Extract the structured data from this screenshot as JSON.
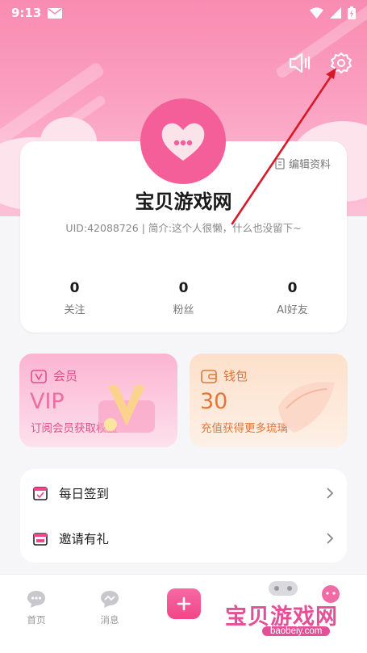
{
  "status_bar": {
    "time": "9:13"
  },
  "profile": {
    "edit_label": "编辑资料",
    "nickname": "宝贝游戏网",
    "bio": "UID:42088726 | 简介:这个人很懒，什么也没留下~",
    "stats": [
      {
        "value": "0",
        "label": "关注"
      },
      {
        "value": "0",
        "label": "粉丝"
      },
      {
        "value": "0",
        "label": "AI好友"
      }
    ]
  },
  "promos": {
    "vip": {
      "title": "会员",
      "value": "VIP",
      "subtitle": "订阅会员获取权益"
    },
    "wallet": {
      "title": "钱包",
      "value": "30",
      "subtitle": "充值获得更多琉璃"
    }
  },
  "menu": {
    "items": [
      {
        "label": "每日签到",
        "icon": "calendar-check-icon"
      },
      {
        "label": "邀请有礼",
        "icon": "gift-calendar-icon"
      }
    ]
  },
  "tabbar": {
    "tabs": [
      {
        "label": "首页",
        "icon": "chat-bubble-icon"
      },
      {
        "label": "消息",
        "icon": "message-icon"
      }
    ]
  },
  "watermark": {
    "title": "宝贝游戏网",
    "url": "baobeiy.com"
  },
  "colors": {
    "accent": "#f0468a",
    "vip": "#e14f8b",
    "wallet": "#e0773a",
    "annotation_arrow": "#d8192a"
  }
}
